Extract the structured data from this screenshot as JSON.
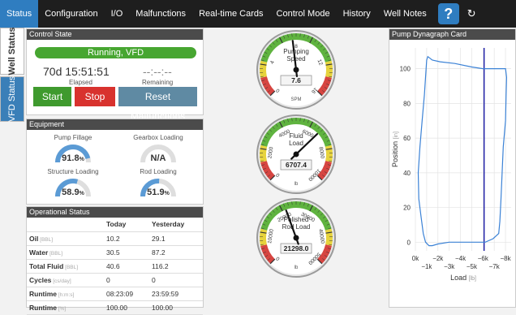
{
  "nav": {
    "tabs": [
      "Status",
      "Configuration",
      "I/O",
      "Malfunctions",
      "Real-time Cards",
      "Control Mode",
      "History",
      "Well Notes"
    ],
    "help_label": "?",
    "refresh_icon": "↻"
  },
  "side_tabs": {
    "well_status": "Well Status",
    "vfd_status": "VFD Status"
  },
  "control_state": {
    "title": "Control State",
    "state": "Running, VFD",
    "elapsed_value": "70d 15:51:51",
    "elapsed_label": "Elapsed",
    "remaining_value": "--:--:--",
    "remaining_label": "Remaining",
    "start_label": "Start",
    "stop_label": "Stop",
    "reset_label": "Reset Malfunctions"
  },
  "equipment": {
    "title": "Equipment",
    "pump_fillage": {
      "label": "Pump Fillage",
      "value": "91.8",
      "unit": "%",
      "fraction": 0.918
    },
    "gearbox_loading": {
      "label": "Gearbox Loading",
      "value": "N/A",
      "unit": "",
      "fraction": 0
    },
    "structure_loading": {
      "label": "Structure Loading",
      "value": "58.9",
      "unit": "%",
      "fraction": 0.589
    },
    "rod_loading": {
      "label": "Rod Loading",
      "value": "51.9",
      "unit": "%",
      "fraction": 0.519
    }
  },
  "operational": {
    "title": "Operational Status",
    "col_today": "Today",
    "col_yesterday": "Yesterday",
    "rows": [
      {
        "label": "Oil",
        "unit": "[BBL]",
        "today": "10.2",
        "yesterday": "29.1"
      },
      {
        "label": "Water",
        "unit": "[BBL]",
        "today": "30.5",
        "yesterday": "87.2"
      },
      {
        "label": "Total Fluid",
        "unit": "[BBL]",
        "today": "40.6",
        "yesterday": "116.2"
      },
      {
        "label": "Cycles",
        "unit": "[cs/day]",
        "today": "0",
        "yesterday": "0"
      },
      {
        "label": "Runtime",
        "unit": "[h:m:s]",
        "today": "08:23:09",
        "yesterday": "23:59:59"
      },
      {
        "label": "Runtime",
        "unit": "[%]",
        "today": "100.00",
        "yesterday": "100.00"
      }
    ]
  },
  "gauges": {
    "pumping_speed": {
      "label_line1": "Pumping",
      "label_line2": "Speed",
      "value": "7.6",
      "unit": "SPM",
      "ticks": [
        "0",
        "4",
        "8",
        "12",
        "16"
      ]
    },
    "fluid_load": {
      "label_line1": "Fluid",
      "label_line2": "Load",
      "value": "6707.4",
      "unit": "lb",
      "ticks": [
        "0",
        "2000",
        "4000",
        "6000",
        "8000",
        "10000"
      ]
    },
    "polished_rod_load": {
      "label_line1": "Polished",
      "label_line2": "Rod Load",
      "value": "21298.0",
      "unit": "lb",
      "ticks": [
        "0",
        "10000",
        "20000",
        "30000",
        "40000",
        "50000"
      ]
    }
  },
  "dynagraph": {
    "title": "Pump Dynagraph Card",
    "chart_data": {
      "type": "line",
      "title": "Pump Dynagraph Card",
      "xlabel": "Load",
      "xunit": "[lb]",
      "ylabel": "Position",
      "yunit": "[in]",
      "xlim": [
        0,
        -8500
      ],
      "ylim": [
        -5,
        112
      ],
      "x_ticks_upper": [
        "0k",
        "−2k",
        "−4k",
        "−6k",
        "−8k"
      ],
      "x_ticks_lower": [
        "−1k",
        "−3k",
        "−5k",
        "−7k"
      ],
      "y_ticks": [
        "0",
        "20",
        "40",
        "60",
        "80",
        "100"
      ],
      "marker_x": -6100,
      "series": [
        {
          "x": [
            -1200,
            -900,
            -700,
            -500,
            -300,
            -250,
            -400,
            -600,
            -800,
            -900,
            -1000,
            -1100,
            -1500,
            -2200,
            -3500,
            -5000,
            -6000,
            -6500,
            -7500,
            -8000,
            -8100,
            -8050,
            -8000,
            -7800,
            -7700,
            -7600,
            -7500,
            -7400,
            -6900,
            -6200,
            -5000,
            -4000,
            -3000,
            -2000,
            -1500,
            -1200
          ],
          "y": [
            -2,
            0,
            5,
            15,
            25,
            40,
            55,
            70,
            85,
            95,
            105,
            107,
            105,
            104,
            103,
            101,
            100,
            100,
            100,
            100,
            95,
            85,
            70,
            55,
            40,
            25,
            12,
            5,
            2,
            0,
            0,
            0,
            0,
            -1,
            -2,
            -2
          ]
        }
      ]
    }
  }
}
